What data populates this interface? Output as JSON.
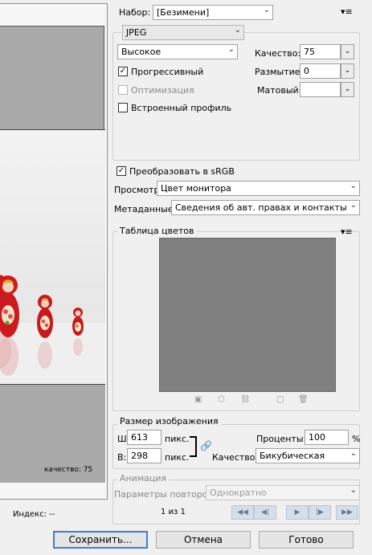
{
  "preview": {
    "quality_caption": "качество: 75",
    "index_caption": "Индекс: --"
  },
  "preset": {
    "label": "Набор:",
    "value": "[Безимени]"
  },
  "format": {
    "value": "JPEG"
  },
  "quality_preset": {
    "value": "Высокое"
  },
  "quality": {
    "label": "Качество:",
    "value": "75"
  },
  "blur": {
    "label": "Размытие:",
    "value": "0"
  },
  "matte": {
    "label": "Матовый:",
    "value": ""
  },
  "options": {
    "progressive": {
      "label": "Прогрессивный",
      "checked": true
    },
    "optimize": {
      "label": "Оптимизация",
      "checked": false,
      "disabled": true
    },
    "embed_profile": {
      "label": "Встроенный профиль",
      "checked": false
    },
    "convert_srgb": {
      "label": "Преобразовать в sRGB",
      "checked": true
    }
  },
  "view": {
    "label": "Просмотр:",
    "value": "Цвет монитора"
  },
  "metadata": {
    "label": "Метаданные:",
    "value": "Сведения об авт. правах и контакты"
  },
  "color_table": {
    "title": "Таблица цветов"
  },
  "image_size": {
    "title": "Размер изображения",
    "width_label": "Ш:",
    "width": "613",
    "width_unit": "пикс.",
    "height_label": "В:",
    "height": "298",
    "height_unit": "пикс.",
    "percent_label": "Проценты:",
    "percent": "100",
    "percent_unit": "%",
    "quality_label": "Качество:",
    "quality": "Бикубическая"
  },
  "animation": {
    "title": "Анимация",
    "loop_label": "Параметры повторов:",
    "loop_value": "Однократно",
    "frame_counter": "1 из 1"
  },
  "buttons": {
    "save": "Сохранить...",
    "cancel": "Отмена",
    "done": "Готово"
  }
}
